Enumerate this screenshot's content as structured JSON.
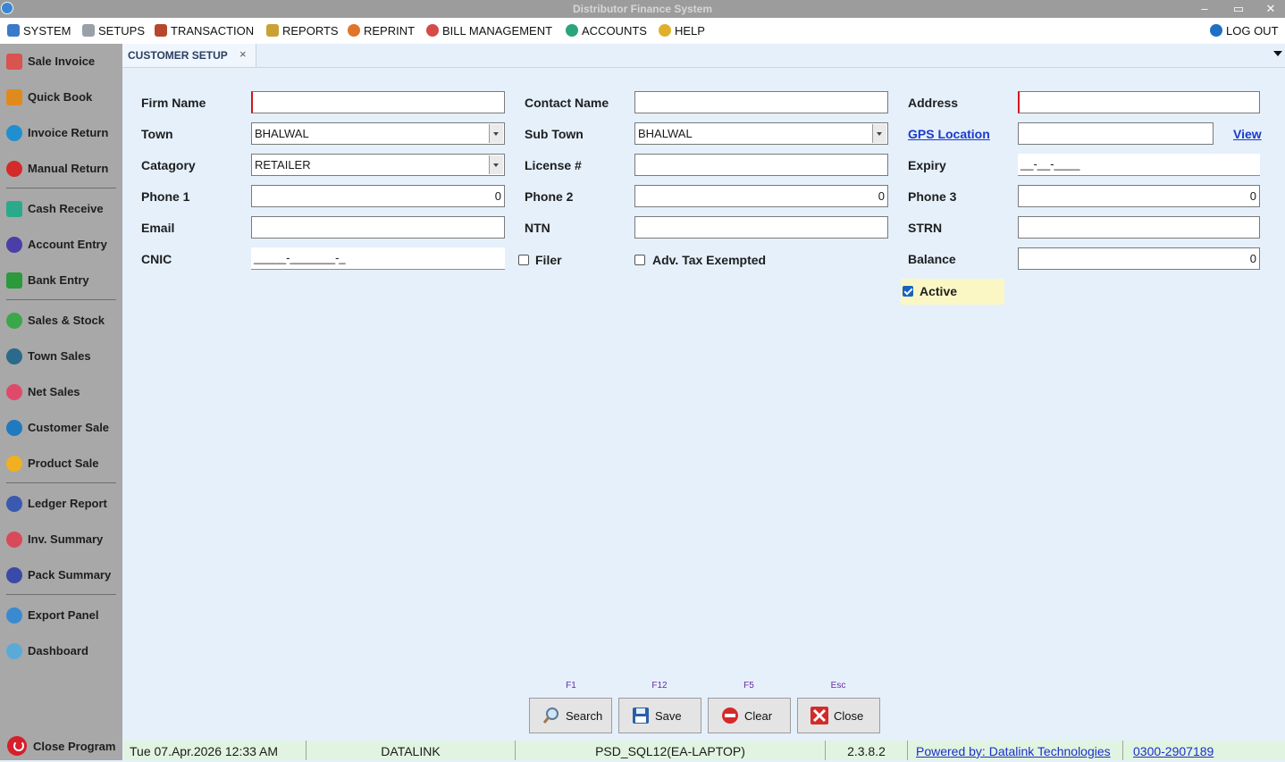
{
  "window": {
    "title": "Distributor Finance System",
    "minimize": "–",
    "restore": "▭",
    "close": "✕"
  },
  "menu": {
    "items": [
      {
        "label": "SYSTEM",
        "icon": "monitor-icon",
        "color": "#3b7ac9"
      },
      {
        "label": "SETUPS",
        "icon": "setup-icon",
        "color": "#9aa0a8"
      },
      {
        "label": "TRANSACTION",
        "icon": "transaction-icon",
        "color": "#b5482c"
      },
      {
        "label": "REPORTS",
        "icon": "reports-icon",
        "color": "#c8a234"
      },
      {
        "label": "REPRINT",
        "icon": "printer-icon",
        "color": "#e0742a"
      },
      {
        "label": "BILL MANAGEMENT",
        "icon": "bill-icon",
        "color": "#d64a4a"
      },
      {
        "label": "ACCOUNTS",
        "icon": "accounts-icon",
        "color": "#2aa57a"
      },
      {
        "label": "HELP",
        "icon": "help-icon",
        "color": "#e0b02a"
      }
    ],
    "logout": {
      "label": "LOG OUT",
      "icon": "lock-icon",
      "color": "#1f6fc4"
    }
  },
  "sidebar": {
    "items": [
      {
        "label": "Sale Invoice",
        "icon": "sale-invoice-icon",
        "color": "#d9534f"
      },
      {
        "label": "Quick Book",
        "icon": "quick-book-icon",
        "color": "#e08a1e"
      },
      {
        "label": "Invoice Return",
        "icon": "invoice-return-icon",
        "color": "#1f8fd0"
      },
      {
        "label": "Manual Return",
        "icon": "manual-return-icon",
        "color": "#d42a2a"
      },
      {
        "label": "Cash Receive",
        "icon": "cash-receive-icon",
        "color": "#2aaa8a"
      },
      {
        "label": "Account Entry",
        "icon": "account-entry-icon",
        "color": "#4a3ea8"
      },
      {
        "label": "Bank Entry",
        "icon": "bank-entry-icon",
        "color": "#2a9a3a"
      },
      {
        "label": "Sales & Stock",
        "icon": "sales-stock-icon",
        "color": "#3aa84a"
      },
      {
        "label": "Town Sales",
        "icon": "town-sales-icon",
        "color": "#2a6a8a"
      },
      {
        "label": "Net Sales",
        "icon": "net-sales-icon",
        "color": "#e04a6a"
      },
      {
        "label": "Customer Sale",
        "icon": "customer-sale-icon",
        "color": "#1f7ac0"
      },
      {
        "label": "Product Sale",
        "icon": "product-sale-icon",
        "color": "#f0b020"
      },
      {
        "label": "Ledger Report",
        "icon": "ledger-report-icon",
        "color": "#3a5ab0"
      },
      {
        "label": "Inv. Summary",
        "icon": "inv-summary-icon",
        "color": "#d84a5a"
      },
      {
        "label": "Pack Summary",
        "icon": "pack-summary-icon",
        "color": "#3a4aa8"
      },
      {
        "label": "Export Panel",
        "icon": "export-panel-icon",
        "color": "#3a8ad0"
      },
      {
        "label": "Dashboard",
        "icon": "dashboard-icon",
        "color": "#5aaad8"
      }
    ],
    "close_program": "Close Program"
  },
  "tab": {
    "label": "CUSTOMER SETUP",
    "close": "×"
  },
  "form": {
    "firm_name": {
      "label": "Firm Name",
      "value": ""
    },
    "contact_name": {
      "label": "Contact Name",
      "value": ""
    },
    "address": {
      "label": "Address",
      "value": ""
    },
    "town": {
      "label": "Town",
      "value": "BHALWAL"
    },
    "sub_town": {
      "label": "Sub Town",
      "value": "BHALWAL"
    },
    "gps": {
      "label": "GPS Location",
      "value": "",
      "view": "View"
    },
    "category": {
      "label": "Catagory",
      "value": "RETAILER"
    },
    "license": {
      "label": "License #",
      "value": ""
    },
    "expiry": {
      "label": "Expiry",
      "value": "__-__-____"
    },
    "phone1": {
      "label": "Phone 1",
      "value": "0"
    },
    "phone2": {
      "label": "Phone 2",
      "value": "0"
    },
    "phone3": {
      "label": "Phone 3",
      "value": "0"
    },
    "email": {
      "label": "Email",
      "value": ""
    },
    "ntn": {
      "label": "NTN",
      "value": ""
    },
    "strn": {
      "label": "STRN",
      "value": ""
    },
    "cnic": {
      "label": "CNIC",
      "value": "_____-_______-_"
    },
    "filer": {
      "label": "Filer",
      "checked": false
    },
    "adv_tax": {
      "label": "Adv. Tax Exempted",
      "checked": false
    },
    "balance": {
      "label": "Balance",
      "value": "0"
    },
    "active": {
      "label": "Active",
      "checked": true
    }
  },
  "actions": [
    {
      "label": "Search",
      "hotkey": "F1",
      "icon": "search-icon"
    },
    {
      "label": "Save",
      "hotkey": "F12",
      "icon": "save-icon"
    },
    {
      "label": "Clear",
      "hotkey": "F5",
      "icon": "clear-icon"
    },
    {
      "label": "Close",
      "hotkey": "Esc",
      "icon": "close-icon"
    }
  ],
  "status": {
    "datetime": "Tue 07.Apr.2026  12:33 AM",
    "company": "DATALINK",
    "server": "PSD_SQL12(EA-LAPTOP)",
    "version": "2.3.8.2",
    "powered": "Powered by: Datalink Technologies",
    "phone": "0300-2907189"
  }
}
